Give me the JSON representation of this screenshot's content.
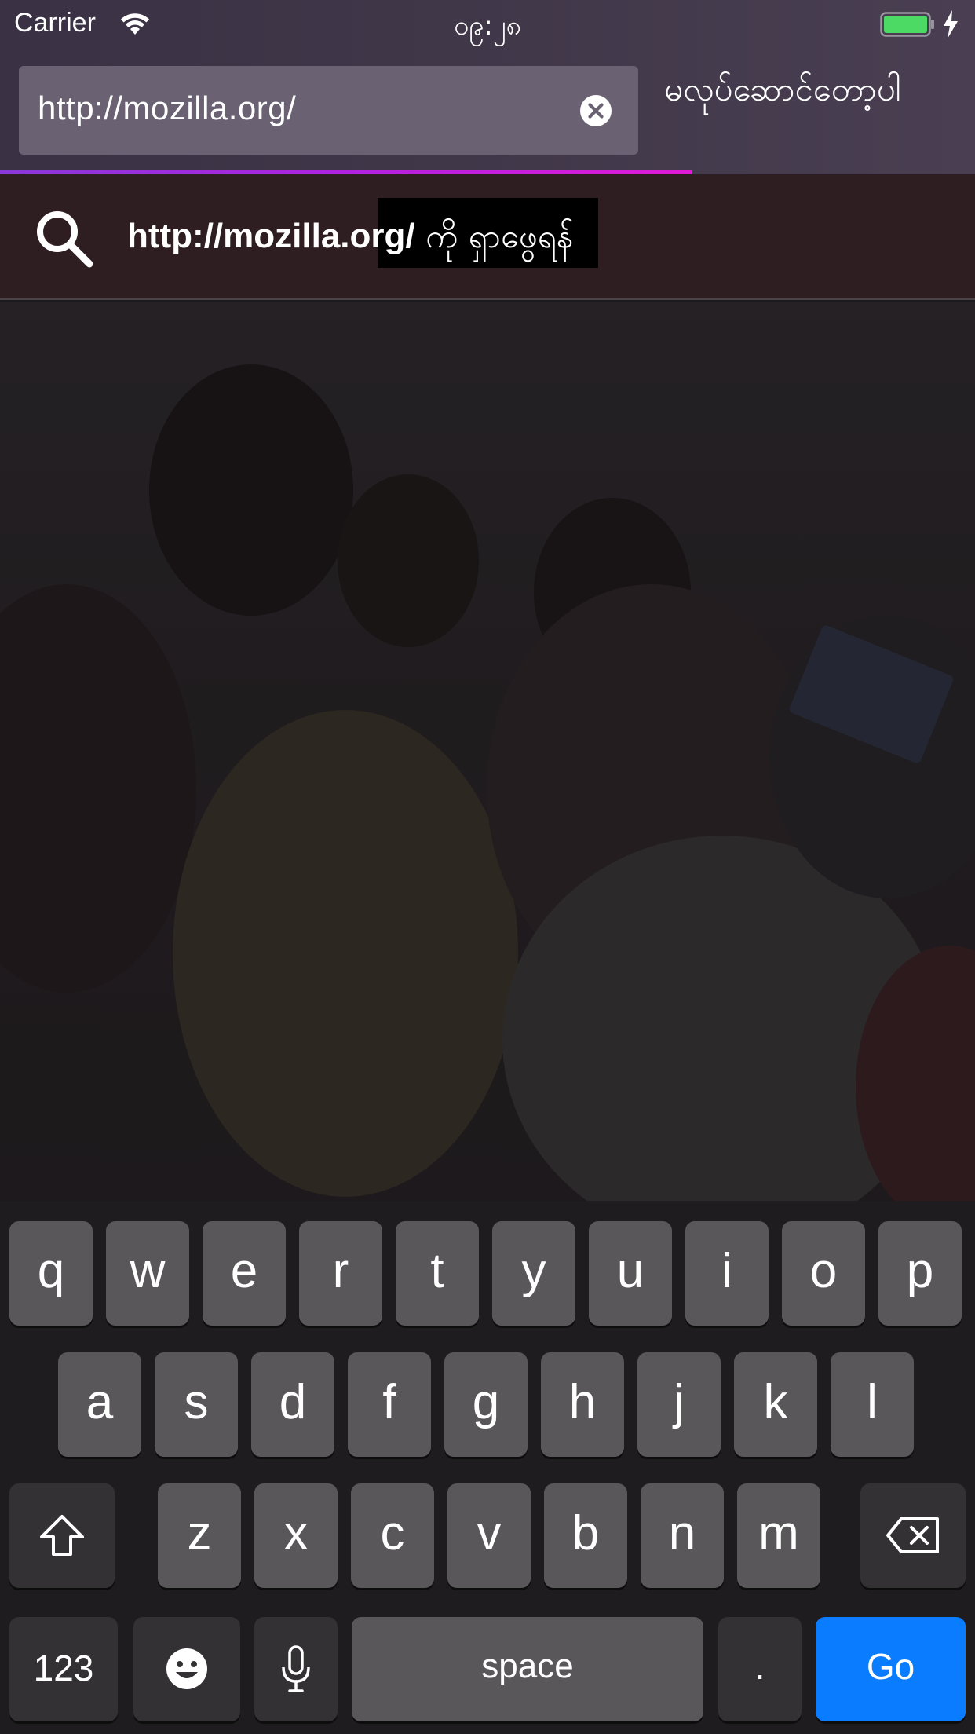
{
  "status_bar": {
    "carrier": "Carrier",
    "time": "၀၉:၂၈",
    "wifi_icon": "wifi-icon",
    "battery_icon": "battery-charging-icon",
    "battery_color": "#4cd964"
  },
  "toolbar": {
    "url_value": "http://mozilla.org/",
    "clear_icon": "clear-icon",
    "cancel_label": "မလုပ်ဆောင်တော့ပါ",
    "progress": 0.71,
    "progress_colors": [
      "#8a38d8",
      "#e01ad6"
    ]
  },
  "suggestion": {
    "search_icon": "search-icon",
    "url": "http://mozilla.org/",
    "suffix": " ကို ရှာဖွေရန်"
  },
  "keyboard": {
    "row1": [
      "q",
      "w",
      "e",
      "r",
      "t",
      "y",
      "u",
      "i",
      "o",
      "p"
    ],
    "row2": [
      "a",
      "s",
      "d",
      "f",
      "g",
      "h",
      "j",
      "k",
      "l"
    ],
    "row3": [
      "z",
      "x",
      "c",
      "v",
      "b",
      "n",
      "m"
    ],
    "numbers_label": "123",
    "space_label": "space",
    "period_label": ".",
    "go_label": "Go",
    "go_color": "#0a7cff"
  }
}
